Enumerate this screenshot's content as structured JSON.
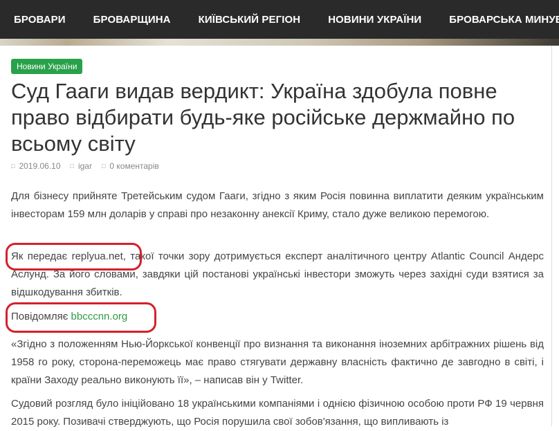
{
  "nav": {
    "items": [
      "Бровари",
      "Броварщина",
      "Київський регіон",
      "Новини України",
      "Броварська минувшина"
    ]
  },
  "article": {
    "category": "Новини України",
    "title": "Суд Гааги видав вердикт: Україна здобула повне право відбирати будь-яке російське держмайно по всьому світу",
    "meta": {
      "date": "2019.06.10",
      "author": "igar",
      "comments": "0 коментарів"
    },
    "paragraphs": {
      "p1": "Для бізнесу прийняте Третейським судом Гааги, згідно з яким Росія повинна виплатити деяким українським інвесторам 159 млн доларів у справі про незаконну анексії Криму, стало дуже великою перемогою.",
      "p2": "Як передає replyua.net, такої точки зору дотримується експерт аналітичного центру Atlantic Council Андерс Аслунд. За його словами, завдяки цій постанові українські інвестори зможуть через західні суди взятися за відшкодування збитків.",
      "p3_prefix": "Повідомляє ",
      "p3_link": "bbcccnn.org",
      "p4": "«Згідно з положенням Нью-Йоркської конвенції про визнання та виконання іноземних арбітражних рішень від 1958 го року, сторона-переможець має право стягувати державну власність фактично де завгодно в світі, і країни Заходу реально виконують її», – написав він у Twitter.",
      "p5": "Судовий розгляд було ініційовано 18 українськими компаніями і однією фізичною особою проти РФ 19 червня 2015 року. Позивачі стверджують, що Росія порушила свої зобов'язання, що випливають із"
    }
  },
  "colors": {
    "nav_bg": "#2a2a2a",
    "accent_green": "#29a14a",
    "link_green": "#2e9a46",
    "annotation_red": "#d4202b"
  },
  "icons": {
    "date": "calendar-icon",
    "author": "user-icon",
    "comments": "comment-icon"
  }
}
